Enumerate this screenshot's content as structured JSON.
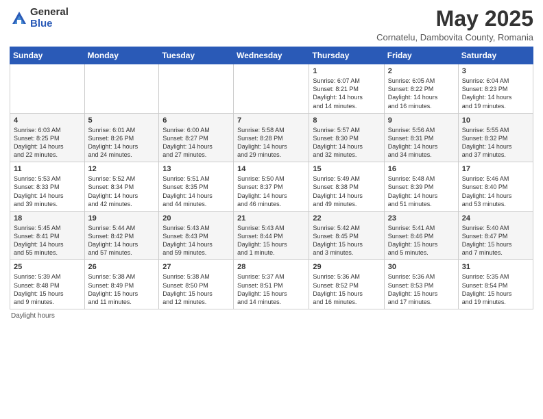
{
  "logo": {
    "general": "General",
    "blue": "Blue"
  },
  "header": {
    "title": "May 2025",
    "subtitle": "Cornatelu, Dambovita County, Romania"
  },
  "weekdays": [
    "Sunday",
    "Monday",
    "Tuesday",
    "Wednesday",
    "Thursday",
    "Friday",
    "Saturday"
  ],
  "weeks": [
    [
      {
        "day": "",
        "info": ""
      },
      {
        "day": "",
        "info": ""
      },
      {
        "day": "",
        "info": ""
      },
      {
        "day": "",
        "info": ""
      },
      {
        "day": "1",
        "info": "Sunrise: 6:07 AM\nSunset: 8:21 PM\nDaylight: 14 hours\nand 14 minutes."
      },
      {
        "day": "2",
        "info": "Sunrise: 6:05 AM\nSunset: 8:22 PM\nDaylight: 14 hours\nand 16 minutes."
      },
      {
        "day": "3",
        "info": "Sunrise: 6:04 AM\nSunset: 8:23 PM\nDaylight: 14 hours\nand 19 minutes."
      }
    ],
    [
      {
        "day": "4",
        "info": "Sunrise: 6:03 AM\nSunset: 8:25 PM\nDaylight: 14 hours\nand 22 minutes."
      },
      {
        "day": "5",
        "info": "Sunrise: 6:01 AM\nSunset: 8:26 PM\nDaylight: 14 hours\nand 24 minutes."
      },
      {
        "day": "6",
        "info": "Sunrise: 6:00 AM\nSunset: 8:27 PM\nDaylight: 14 hours\nand 27 minutes."
      },
      {
        "day": "7",
        "info": "Sunrise: 5:58 AM\nSunset: 8:28 PM\nDaylight: 14 hours\nand 29 minutes."
      },
      {
        "day": "8",
        "info": "Sunrise: 5:57 AM\nSunset: 8:30 PM\nDaylight: 14 hours\nand 32 minutes."
      },
      {
        "day": "9",
        "info": "Sunrise: 5:56 AM\nSunset: 8:31 PM\nDaylight: 14 hours\nand 34 minutes."
      },
      {
        "day": "10",
        "info": "Sunrise: 5:55 AM\nSunset: 8:32 PM\nDaylight: 14 hours\nand 37 minutes."
      }
    ],
    [
      {
        "day": "11",
        "info": "Sunrise: 5:53 AM\nSunset: 8:33 PM\nDaylight: 14 hours\nand 39 minutes."
      },
      {
        "day": "12",
        "info": "Sunrise: 5:52 AM\nSunset: 8:34 PM\nDaylight: 14 hours\nand 42 minutes."
      },
      {
        "day": "13",
        "info": "Sunrise: 5:51 AM\nSunset: 8:35 PM\nDaylight: 14 hours\nand 44 minutes."
      },
      {
        "day": "14",
        "info": "Sunrise: 5:50 AM\nSunset: 8:37 PM\nDaylight: 14 hours\nand 46 minutes."
      },
      {
        "day": "15",
        "info": "Sunrise: 5:49 AM\nSunset: 8:38 PM\nDaylight: 14 hours\nand 49 minutes."
      },
      {
        "day": "16",
        "info": "Sunrise: 5:48 AM\nSunset: 8:39 PM\nDaylight: 14 hours\nand 51 minutes."
      },
      {
        "day": "17",
        "info": "Sunrise: 5:46 AM\nSunset: 8:40 PM\nDaylight: 14 hours\nand 53 minutes."
      }
    ],
    [
      {
        "day": "18",
        "info": "Sunrise: 5:45 AM\nSunset: 8:41 PM\nDaylight: 14 hours\nand 55 minutes."
      },
      {
        "day": "19",
        "info": "Sunrise: 5:44 AM\nSunset: 8:42 PM\nDaylight: 14 hours\nand 57 minutes."
      },
      {
        "day": "20",
        "info": "Sunrise: 5:43 AM\nSunset: 8:43 PM\nDaylight: 14 hours\nand 59 minutes."
      },
      {
        "day": "21",
        "info": "Sunrise: 5:43 AM\nSunset: 8:44 PM\nDaylight: 15 hours\nand 1 minute."
      },
      {
        "day": "22",
        "info": "Sunrise: 5:42 AM\nSunset: 8:45 PM\nDaylight: 15 hours\nand 3 minutes."
      },
      {
        "day": "23",
        "info": "Sunrise: 5:41 AM\nSunset: 8:46 PM\nDaylight: 15 hours\nand 5 minutes."
      },
      {
        "day": "24",
        "info": "Sunrise: 5:40 AM\nSunset: 8:47 PM\nDaylight: 15 hours\nand 7 minutes."
      }
    ],
    [
      {
        "day": "25",
        "info": "Sunrise: 5:39 AM\nSunset: 8:48 PM\nDaylight: 15 hours\nand 9 minutes."
      },
      {
        "day": "26",
        "info": "Sunrise: 5:38 AM\nSunset: 8:49 PM\nDaylight: 15 hours\nand 11 minutes."
      },
      {
        "day": "27",
        "info": "Sunrise: 5:38 AM\nSunset: 8:50 PM\nDaylight: 15 hours\nand 12 minutes."
      },
      {
        "day": "28",
        "info": "Sunrise: 5:37 AM\nSunset: 8:51 PM\nDaylight: 15 hours\nand 14 minutes."
      },
      {
        "day": "29",
        "info": "Sunrise: 5:36 AM\nSunset: 8:52 PM\nDaylight: 15 hours\nand 16 minutes."
      },
      {
        "day": "30",
        "info": "Sunrise: 5:36 AM\nSunset: 8:53 PM\nDaylight: 15 hours\nand 17 minutes."
      },
      {
        "day": "31",
        "info": "Sunrise: 5:35 AM\nSunset: 8:54 PM\nDaylight: 15 hours\nand 19 minutes."
      }
    ]
  ],
  "footer": "Daylight hours"
}
